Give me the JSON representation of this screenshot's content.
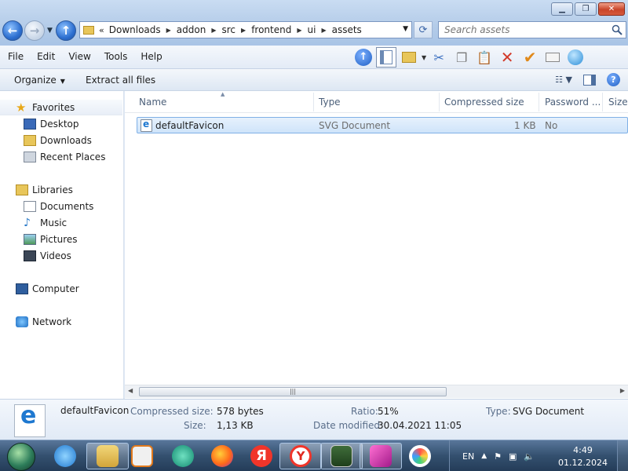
{
  "window": {
    "address_path": [
      "Downloads",
      "addon",
      "src",
      "frontend",
      "ui",
      "assets"
    ],
    "search_placeholder": "Search assets"
  },
  "menu": [
    "File",
    "Edit",
    "View",
    "Tools",
    "Help"
  ],
  "toolbar_icons": [
    "up-folder-icon",
    "view-pane-icon",
    "folder-check-icon",
    "cut-icon",
    "copy-icon",
    "paste-icon",
    "delete-icon",
    "check-icon",
    "properties-icon",
    "web-icon"
  ],
  "commands": {
    "organize": "Organize",
    "extract": "Extract all files"
  },
  "nav": {
    "favorites": "Favorites",
    "favorites_items": [
      "Desktop",
      "Downloads",
      "Recent Places"
    ],
    "libraries": "Libraries",
    "libraries_items": [
      "Documents",
      "Music",
      "Pictures",
      "Videos"
    ],
    "computer": "Computer",
    "network": "Network"
  },
  "columns": {
    "name": "Name",
    "type": "Type",
    "compressed": "Compressed size",
    "password": "Password ...",
    "size": "Size"
  },
  "files": [
    {
      "name": "defaultFavicon",
      "type": "SVG Document",
      "compressed": "1 KB",
      "password": "No"
    }
  ],
  "details": {
    "name": "defaultFavicon",
    "compressed_label": "Compressed size:",
    "compressed_value": "578 bytes",
    "size_label": "Size:",
    "size_value": "1,13 KB",
    "ratio_label": "Ratio:",
    "ratio_value": "51%",
    "modified_label": "Date modified:",
    "modified_value": "30.04.2021 11:05",
    "type_label": "Type:",
    "type_value": "SVG Document"
  },
  "taskbar": {
    "apps": [
      "internet-explorer",
      "file-explorer",
      "media-player",
      "green-app",
      "firefox",
      "yandex",
      "yandex-browser",
      "monitor-app",
      "pink-app",
      "circle-app"
    ],
    "lang": "EN",
    "time": "4:49",
    "date": "01.12.2024"
  },
  "colors": {
    "title_gradient": "#b3cbe8",
    "selection": "#cfe4fa",
    "close": "#c9452a",
    "taskbar": "#34506f"
  }
}
